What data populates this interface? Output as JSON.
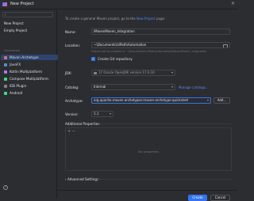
{
  "window": {
    "title": "New Project",
    "close_glyph": "✕"
  },
  "sidebar": {
    "search_glyph": "⌕",
    "items": [
      {
        "label": "New Project"
      },
      {
        "label": "Empty Project"
      }
    ],
    "section_label": "Generators",
    "generators": [
      {
        "label": "Maven Archetype",
        "icon_color": "#e06c75",
        "selected": true
      },
      {
        "label": "JavaFX",
        "icon_color": "#4f8fd9"
      },
      {
        "label": "Kotlin Multiplatform",
        "icon_color": "#a97bff"
      },
      {
        "label": "Compose Multiplatform",
        "icon_color": "#3ddc84"
      },
      {
        "label": "IDE Plugin",
        "icon_color": "#7f838a"
      },
      {
        "label": "Android",
        "icon_color": "#3ddc84"
      }
    ]
  },
  "main": {
    "info_prefix": "To create a general Maven project, go to the",
    "info_link": "New Project",
    "info_suffix": "page.",
    "name_label": "Name:",
    "name_value": "iMavenMaven_Integration",
    "location_label": "Location:",
    "location_value": "~\\Documents\\UiPath\\Automation",
    "location_hint": "Project will be created in: ~\\Documents\\UiPath\\Automation\\iMavenMaven_Integration",
    "git_label": "Create Git repository",
    "jdk_label": "JDK:",
    "jdk_value": "17 Oracle OpenJDK version 17.0.10",
    "catalog_label": "Catalog:",
    "catalog_value": "Internal",
    "manage_catalogs": "Manage catalogs...",
    "archetype_label": "Archetype:",
    "archetype_value": "org.apache.maven.archetypes:maven-archetype-quickstart",
    "add_button": "Add...",
    "version_label": "Version:",
    "version_value": "1.1",
    "additional_props_title": "Additional Properties",
    "props_add_glyph": "+ −",
    "props_empty": "No properties",
    "advanced_settings": "› Advanced Settings",
    "select_arrow": "▾",
    "checkmark": "✓",
    "help_glyph": "?"
  },
  "footer": {
    "create_button": "Create",
    "cancel_button": "Cancel"
  }
}
